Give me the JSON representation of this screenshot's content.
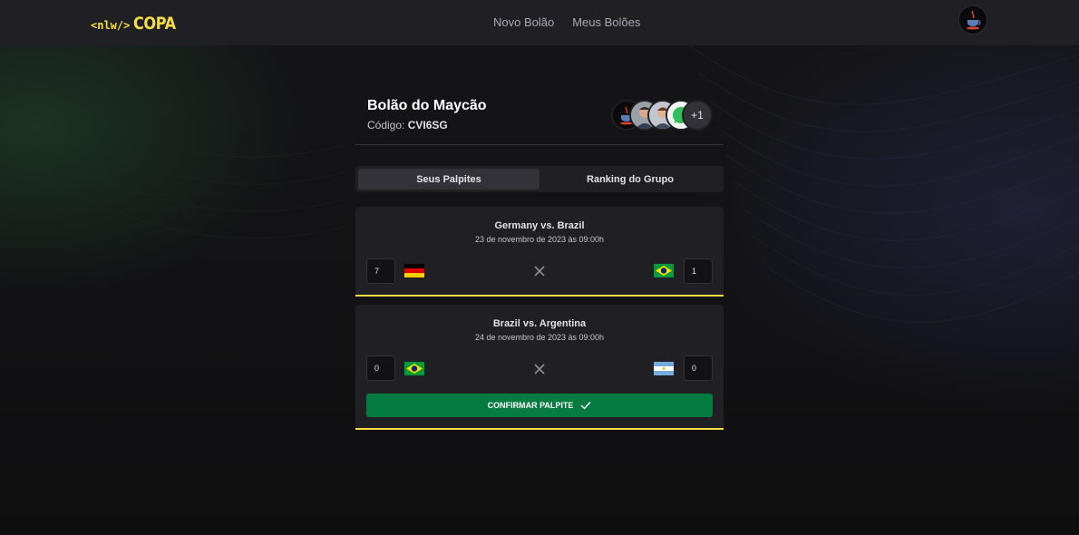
{
  "app": {
    "logo_tag": "<nlw/>",
    "logo_name": "COPA"
  },
  "nav": {
    "items": [
      {
        "label": "Novo Bolão"
      },
      {
        "label": "Meus Bolões"
      }
    ]
  },
  "pool": {
    "title": "Bolão do Maycão",
    "code_label": "Código:",
    "code": "CVI6SG",
    "participants_extra": "+1"
  },
  "tabs": [
    {
      "label": "Seus Palpites",
      "active": true
    },
    {
      "label": "Ranking do Grupo",
      "active": false
    }
  ],
  "games": [
    {
      "title": "Germany vs. Brazil",
      "date": "23 de novembro de 2023 às 09:00h",
      "home_score": "7",
      "away_score": "1",
      "home_flag": "germany-flag",
      "away_flag": "brazil-flag"
    },
    {
      "title": "Brazil vs. Argentina",
      "date": "24 de novembro de 2023 às 09:00h",
      "home_score": "0",
      "away_score": "0",
      "home_flag": "brazil-flag",
      "away_flag": "argentina-flag",
      "confirm_label": "CONFIRMAR PALPITE"
    }
  ],
  "colors": {
    "accent": "#f7dd43",
    "confirm": "#047c3f",
    "header_bg": "#202024",
    "page_bg": "#121214"
  }
}
